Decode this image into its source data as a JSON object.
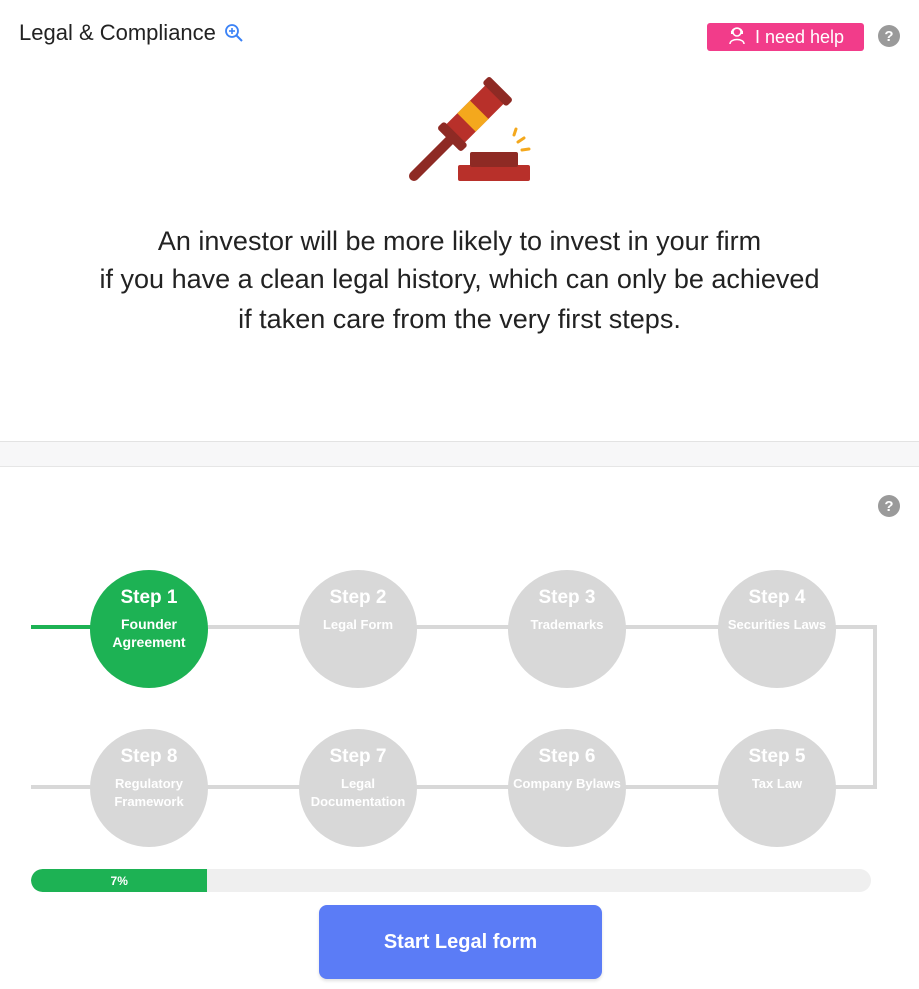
{
  "header": {
    "title": "Legal & Compliance",
    "help_label": "I need help"
  },
  "icons": {
    "zoom": "zoom-in-icon",
    "help_person": "support-agent-icon",
    "question": "question-circle-icon",
    "hero": "gavel-icon"
  },
  "intro": {
    "line1": "An investor will be more likely to invest in your firm",
    "line2": "if you have a clean legal history, which can only be achieved",
    "line3": "if taken care from the very first steps."
  },
  "question_mark": "?",
  "steps": [
    {
      "step": "Step 1",
      "label": [
        "Founder",
        "Agreement"
      ],
      "active": true
    },
    {
      "step": "Step 2",
      "label": [
        "Legal Form"
      ],
      "active": false
    },
    {
      "step": "Step 3",
      "label": [
        "Trademarks"
      ],
      "active": false
    },
    {
      "step": "Step 4",
      "label": [
        "Securities Laws"
      ],
      "active": false
    },
    {
      "step": "Step 5",
      "label": [
        "Tax Law"
      ],
      "active": false
    },
    {
      "step": "Step 6",
      "label": [
        "Company Bylaws"
      ],
      "active": false
    },
    {
      "step": "Step 7",
      "label": [
        "Legal",
        "Documentation"
      ],
      "active": false
    },
    {
      "step": "Step 8",
      "label": [
        "Regulatory",
        "Framework"
      ],
      "active": false
    }
  ],
  "progress": {
    "value": 0.07,
    "label": "7%"
  },
  "cta": {
    "label": "Start Legal form"
  },
  "colors": {
    "accent_green": "#1db254",
    "inactive_gray": "#d8d8d8",
    "help_pink": "#f23c8a",
    "button_blue": "#5b7cf6",
    "link_blue": "#3b82f6"
  }
}
